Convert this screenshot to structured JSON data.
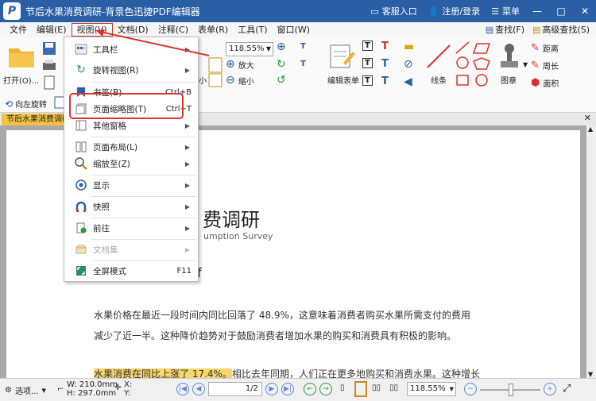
{
  "title_bar": {
    "title": "节后水果消费调研-背景色迅捷PDF编辑器",
    "service": "客服入口",
    "account": "注册/登录",
    "menu": "菜单"
  },
  "menubar": {
    "items": [
      "文件",
      "编辑(E)",
      "视图(V)",
      "文档(D)",
      "注释(C)",
      "表单(R)",
      "工具(T)",
      "窗口(W)"
    ],
    "find": "查找(F)",
    "advanced_find": "高级查找(S)"
  },
  "ribbon": {
    "open": "打开(O)...",
    "rotate_left": "向左旋转",
    "zoom_value": "118.55%",
    "zoom_in": "放大",
    "zoom_out": "缩小",
    "small": "小",
    "edit_form": "编辑表单",
    "line": "线条",
    "stamp": "图章",
    "distance": "距离",
    "perimeter": "周长",
    "area": "面积"
  },
  "tab": {
    "doc_tab": "节后水果消费调研"
  },
  "view_menu": {
    "items": [
      {
        "label": "工具栏",
        "icon": "toolbar-icon",
        "arrow": true,
        "shortcut": ""
      },
      {
        "label": "旋转视图(R)",
        "icon": "rotate-view-icon",
        "arrow": true,
        "shortcut": ""
      },
      {
        "label": "书签(B)",
        "icon": "bookmark-icon",
        "arrow": false,
        "shortcut": "Ctrl+B"
      },
      {
        "label": "页面缩略图(T)",
        "icon": "page-thumbnail-icon",
        "arrow": false,
        "shortcut": "Ctrl+T"
      },
      {
        "label": "其他窗格",
        "icon": "other-panes-icon",
        "arrow": true,
        "shortcut": ""
      },
      {
        "label": "页面布局(L)",
        "icon": "page-layout-icon",
        "arrow": true,
        "shortcut": ""
      },
      {
        "label": "缩放至(Z)",
        "icon": "zoom-to-icon",
        "arrow": true,
        "shortcut": ""
      },
      {
        "label": "显示",
        "icon": "display-icon",
        "arrow": true,
        "shortcut": ""
      },
      {
        "label": "快照",
        "icon": "snapshot-icon",
        "arrow": true,
        "shortcut": ""
      },
      {
        "label": "前往",
        "icon": "goto-icon",
        "arrow": true,
        "shortcut": ""
      },
      {
        "label": "文档集",
        "icon": "document-set-icon",
        "arrow": true,
        "shortcut": "",
        "disabled": true
      },
      {
        "label": "全屏模式",
        "icon": "fullscreen-icon",
        "arrow": false,
        "shortcut": "F11"
      }
    ]
  },
  "document": {
    "title_fragment": "费调研",
    "subtitle_fragment": "umption Survey",
    "line_fragment": "f",
    "para1_line1": "水果价格在最近一段时间内同比回落了  48.9%，这意味着消费者购买水果所需支付的费用",
    "para1_line2": "减少了近一半。这种降价趋势对于鼓励消费者增加水果的购买和消费具有积极的影响。",
    "para2_highlight": "水果消费在同比上涨了 17.4%。",
    "para2_rest": "相比去年同期，人们正在更多地购买和消费水果。这种增长"
  },
  "statusbar": {
    "options": "选项...",
    "width": "W: 210.0mm",
    "height": "H: 297.0mm",
    "x": "X:",
    "y": "Y:",
    "page": "1",
    "page_total": "/2",
    "zoom": "118.55%"
  },
  "colors": {
    "titlebar": "#2b5fa5",
    "highlight": "#f5d76e",
    "annotation_red": "#d9342b",
    "tab_active": "#f5c243"
  }
}
